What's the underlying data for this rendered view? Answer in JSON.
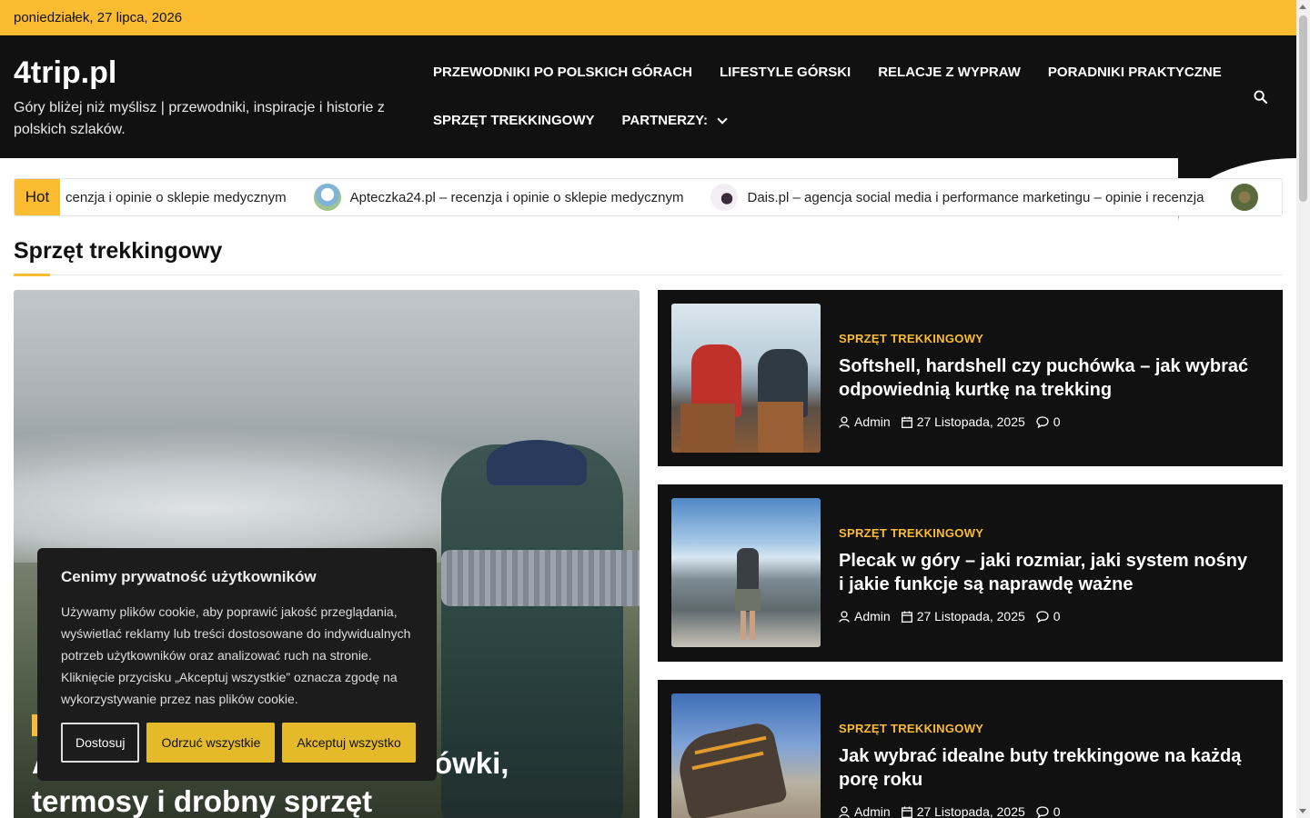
{
  "topbar": {
    "date": "poniedziałek, 27 lipca, 2026"
  },
  "brand": {
    "logo": "4trip.pl",
    "tagline": "Góry bliżej niż myślisz | przewodniki, inspiracje i historie z polskich szlaków."
  },
  "nav": {
    "items": [
      "PRZEWODNIKI PO POLSKICH GÓRACH",
      "LIFESTYLE GÓRSKI",
      "RELACJE Z WYPRAW",
      "PORADNIKI PRAKTYCZNE",
      "SPRZĘT TREKKINGOWY",
      "PARTNERZY:"
    ],
    "search_icon": "search-icon"
  },
  "ticker": {
    "label": "Hot",
    "items": [
      "cenzja i opinie o sklepie medycznym",
      "Apteczka24.pl – recenzja i opinie o sklepie medycznym",
      "Dais.pl – agencja social media i performance marketingu – opinie i recenzja"
    ]
  },
  "section": {
    "title": "Sprzęt trekkingowy"
  },
  "hero": {
    "title": "A… obią różnicę – kijki, czołówki, termosy i drobny sprzęt"
  },
  "cards": [
    {
      "category": "SPRZĘT TREKKINGOWY",
      "title": "Softshell, hardshell czy puchówka – jak wybrać odpowiednią kurtkę na trekking",
      "author": "Admin",
      "date": "27 Listopada, 2025",
      "comments": "0"
    },
    {
      "category": "SPRZĘT TREKKINGOWY",
      "title": "Plecak w góry – jaki rozmiar, jaki system nośny i jakie funkcje są naprawdę ważne",
      "author": "Admin",
      "date": "27 Listopada, 2025",
      "comments": "0"
    },
    {
      "category": "SPRZĘT TREKKINGOWY",
      "title": "Jak wybrać idealne buty trekkingowe na każdą porę roku",
      "author": "Admin",
      "date": "27 Listopada, 2025",
      "comments": "0"
    }
  ],
  "cookie": {
    "title": "Cenimy prywatność użytkowników",
    "text": "Używamy plików cookie, aby poprawić jakość przeglądania, wyświetlać reklamy lub treści dostosowane do indywidualnych potrzeb użytkowników oraz analizować ruch na stronie. Kliknięcie przycisku „Akceptuj wszystkie” oznacza zgodę na wykorzystywanie przez nas plików cookie.",
    "customize": "Dostosuj",
    "reject": "Odrzuć wszystkie",
    "accept": "Akceptuj wszystko"
  },
  "colors": {
    "accent": "#fcbc31",
    "dark": "#111111",
    "button": "#e4b92a"
  }
}
